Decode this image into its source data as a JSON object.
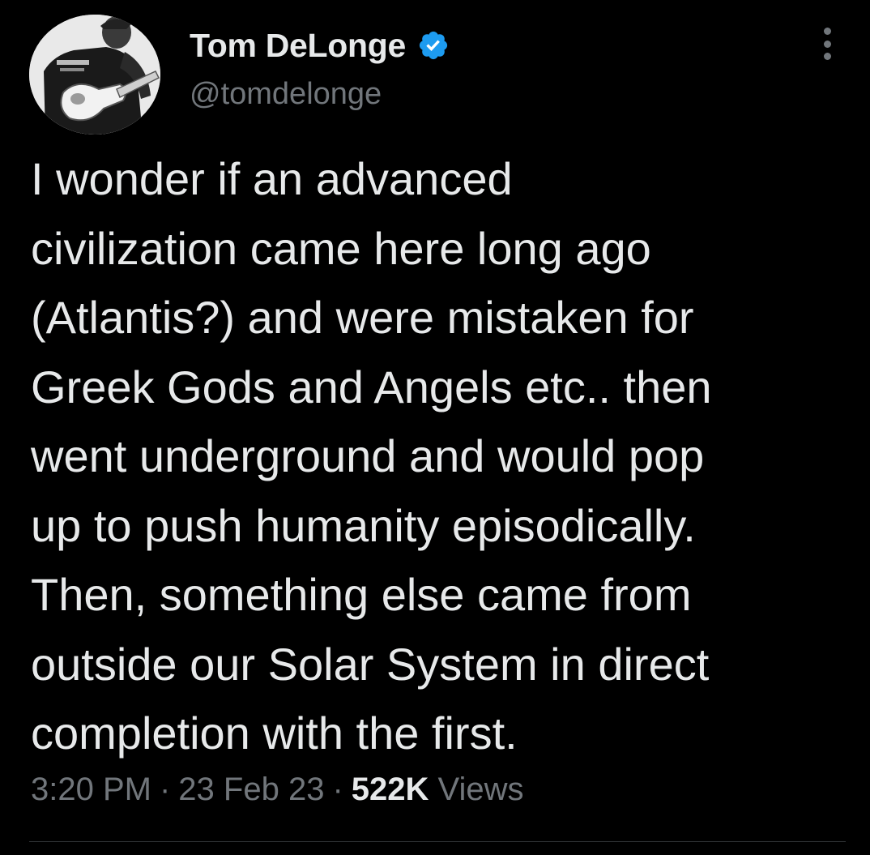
{
  "author": {
    "display_name": "Tom DeLonge",
    "handle": "@tomdelonge",
    "verified": true,
    "verified_color": "#1d9bf0",
    "avatar_icon": "profile-photo-guitarist"
  },
  "tweet": {
    "lines": [
      "I wonder if an advanced",
      "civilization came here long ago",
      "(Atlantis?) and were mistaken for",
      "Greek Gods and Angels etc.. then",
      "went underground and would pop",
      "up to push humanity episodically.",
      "Then, something else came from",
      "outside our Solar System in direct",
      "completion with the first."
    ]
  },
  "meta": {
    "time": "3:20 PM",
    "separator": "·",
    "date": "23 Feb 23",
    "views_count": "522K",
    "views_label": "Views"
  },
  "more_icon": "more-horizontal-icon"
}
